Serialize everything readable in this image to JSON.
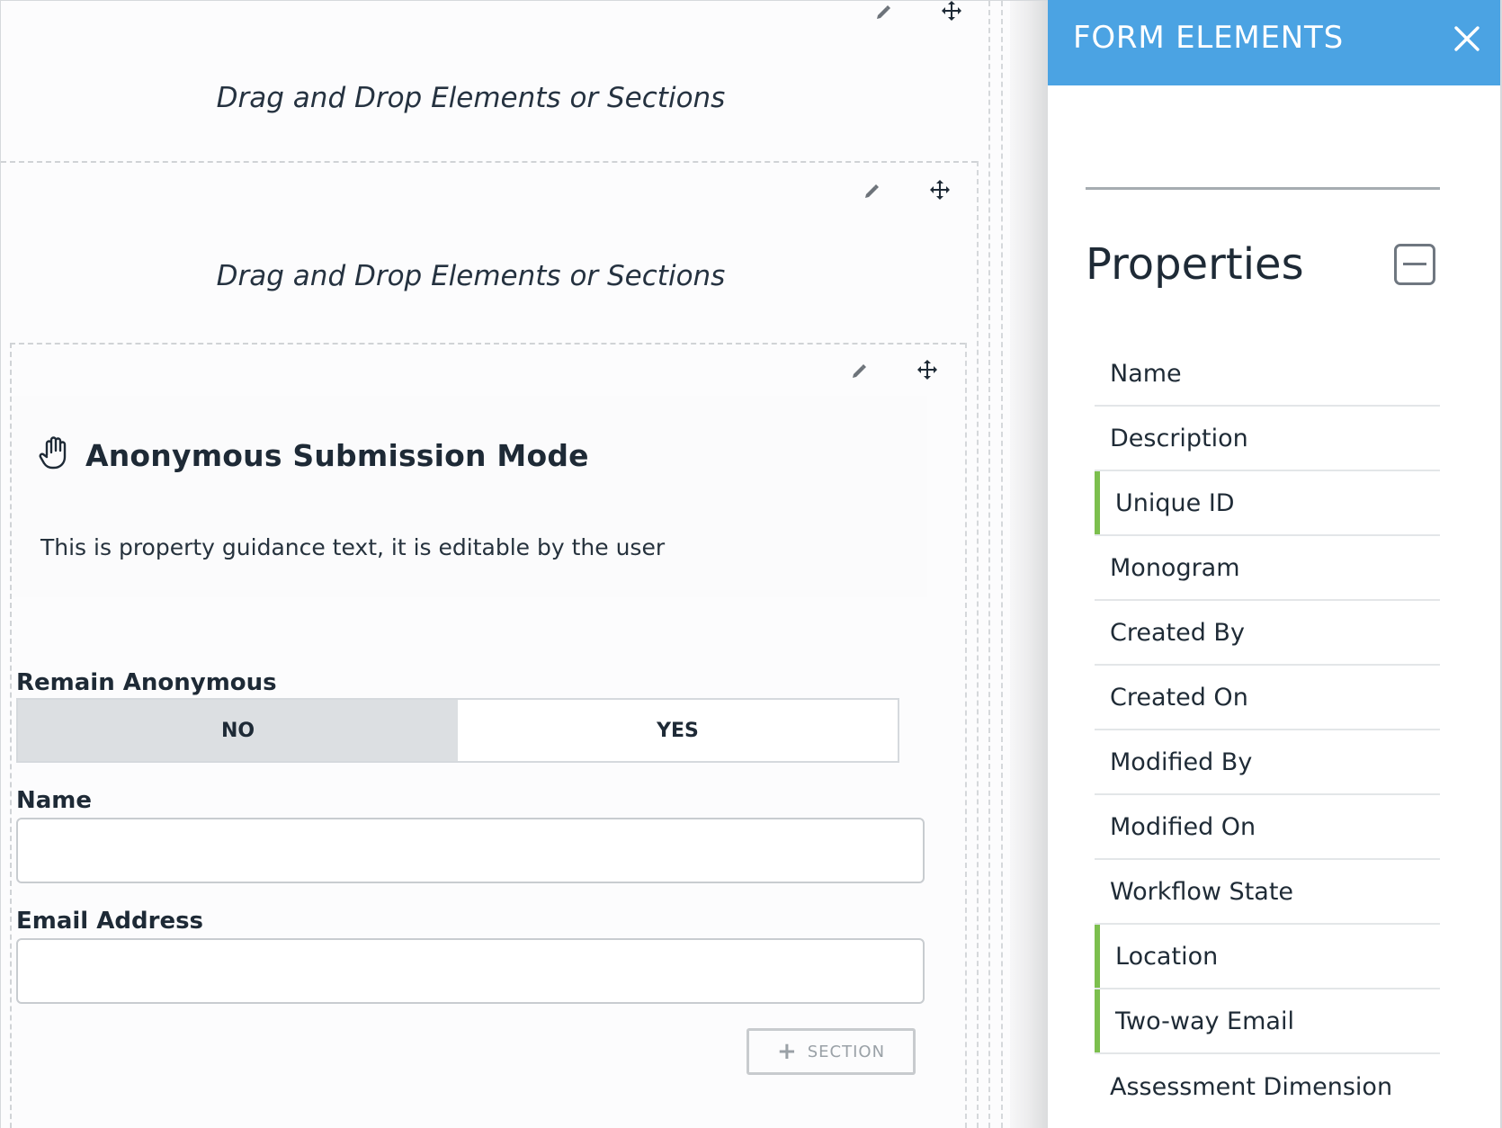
{
  "canvas": {
    "drop_hint_1": "Drag and Drop Elements or Sections",
    "drop_hint_2": "Drag and Drop Elements or Sections",
    "section": {
      "title": "Anonymous Submission Mode",
      "title_icon": "hand-icon",
      "guidance": "This is property guidance text, it is editable by the user"
    },
    "fields": {
      "remain_anonymous": {
        "label": "Remain Anonymous",
        "options": [
          "NO",
          "YES"
        ],
        "selected": "NO"
      },
      "name": {
        "label": "Name",
        "value": ""
      },
      "email": {
        "label": "Email Address",
        "value": ""
      }
    },
    "add_section_label": "SECTION",
    "tool_icons": [
      "pencil-icon",
      "move-icon"
    ]
  },
  "panel": {
    "title": "FORM ELEMENTS",
    "close_icon": "close-icon",
    "properties_heading": "Properties",
    "collapse_icon": "collapse-icon",
    "properties": [
      {
        "label": "Name",
        "marked": false
      },
      {
        "label": "Description",
        "marked": false
      },
      {
        "label": "Unique ID",
        "marked": true
      },
      {
        "label": "Monogram",
        "marked": false
      },
      {
        "label": "Created By",
        "marked": false
      },
      {
        "label": "Created On",
        "marked": false
      },
      {
        "label": "Modified By",
        "marked": false
      },
      {
        "label": "Modified On",
        "marked": false
      },
      {
        "label": "Workflow State",
        "marked": false
      },
      {
        "label": "Location",
        "marked": true
      },
      {
        "label": "Two-way Email",
        "marked": true
      },
      {
        "label": "Assessment Dimension",
        "marked": false
      }
    ]
  },
  "colors": {
    "header_blue": "#4ba3e3",
    "marker_green": "#7cbf4e",
    "toggle_selected": "#dcdfe2"
  }
}
